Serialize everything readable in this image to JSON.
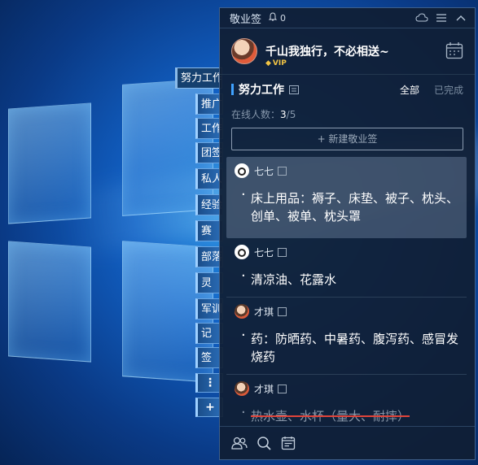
{
  "app": {
    "title": "敬业签",
    "notif_count": "0"
  },
  "user": {
    "name": "千山我独行，不必相送~",
    "badge": "VIP"
  },
  "section": {
    "title": "努力工作",
    "filter_all": "全部",
    "filter_done": "已完成"
  },
  "online": {
    "label": "在线人数：",
    "current": "3",
    "total": "/5"
  },
  "new_button": "+ 新建敬业签",
  "notes": [
    {
      "author": "七七",
      "text": "床上用品：褥子、床垫、被子、枕头、创单、被单、枕头罩",
      "done": false
    },
    {
      "author": "七七",
      "text": "清凉油、花露水",
      "done": false
    },
    {
      "author": "才琪",
      "text": "药：防晒药、中暑药、腹泻药、感冒发烧药",
      "done": false
    },
    {
      "author": "才琪",
      "text": "热水壶、水杯（量大、耐摔）",
      "done": true
    }
  ],
  "tabs": {
    "active": "努力工作",
    "items": [
      "推广",
      "工作",
      "团签",
      "私人",
      "经验",
      "赛",
      "部落",
      "灵",
      "军训",
      "记",
      "签"
    ],
    "more": "⋮",
    "add": "+"
  },
  "colors": {
    "accent": "#3fa2ff",
    "panel": "#101e34",
    "done_strike": "#e0443a",
    "vip": "#f2c444"
  },
  "icons": [
    "bell-icon",
    "cloud-sync-icon",
    "menu-icon",
    "collapse-icon",
    "calendar-icon",
    "members-icon",
    "search-icon",
    "notes-list-icon"
  ]
}
